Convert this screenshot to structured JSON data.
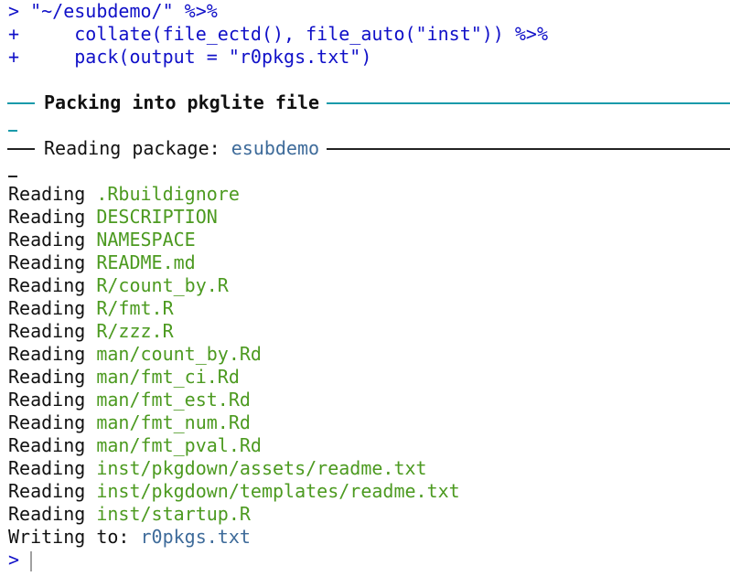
{
  "console": {
    "input_lines": [
      {
        "prompt": ">",
        "text": " \"~/esubdemo/\" %>%"
      },
      {
        "prompt": "+",
        "text": "     collate(file_ectd(), file_auto(\"inst\")) %>%"
      },
      {
        "prompt": "+",
        "text": "     pack(output = \"r0pkgs.txt\")"
      }
    ],
    "section1": {
      "title": "Packing into pkglite file"
    },
    "section2": {
      "label": "Reading package: ",
      "package": "esubdemo"
    },
    "reading_word": "Reading",
    "files": [
      ".Rbuildignore",
      "DESCRIPTION",
      "NAMESPACE",
      "README.md",
      "R/count_by.R",
      "R/fmt.R",
      "R/zzz.R",
      "man/count_by.Rd",
      "man/fmt_ci.Rd",
      "man/fmt_est.Rd",
      "man/fmt_num.Rd",
      "man/fmt_pval.Rd",
      "inst/pkgdown/assets/readme.txt",
      "inst/pkgdown/templates/readme.txt",
      "inst/startup.R"
    ],
    "writing": {
      "label": "Writing to: ",
      "file": "r0pkgs.txt"
    },
    "final_prompt": ">"
  },
  "colors": {
    "input": "#1010c8",
    "rule": "#1a9aaa",
    "highlight": "#3e6b9a",
    "file": "#4c9a20"
  }
}
